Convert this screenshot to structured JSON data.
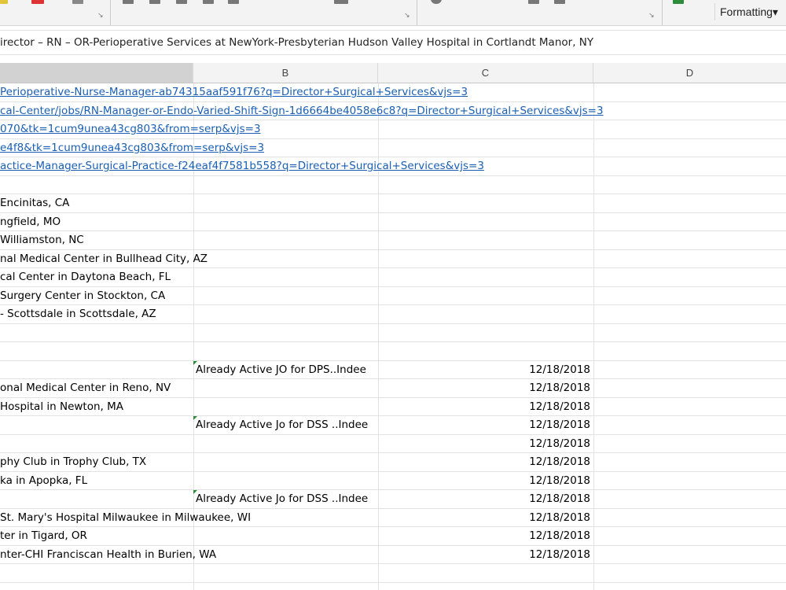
{
  "ribbon": {
    "formatting_label": "Formatting",
    "dropdown_glyph": "▾",
    "launcher_glyph": "↘"
  },
  "formula_bar": {
    "value": "irector – RN – OR-Perioperative Services at NewYork-Presbyterian Hudson Valley Hospital in Cortlandt Manor, NY"
  },
  "columns": [
    {
      "label": ""
    },
    {
      "label": "B"
    },
    {
      "label": "C"
    },
    {
      "label": "D"
    }
  ],
  "rows": [
    {
      "a": "Perioperative-Nurse-Manager-ab74315aaf591f76?q=Director+Surgical+Services&vjs=3",
      "a_link": true,
      "b": "",
      "c": ""
    },
    {
      "a": "cal-Center/jobs/RN-Manager-or-Endo-Varied-Shift-Sign-1d6664be4058e6c8?q=Director+Surgical+Services&vjs=3",
      "a_link": true,
      "b": "",
      "c": ""
    },
    {
      "a": "070&tk=1cum9unea43cg803&from=serp&vjs=3",
      "a_link": true,
      "b": "",
      "c": ""
    },
    {
      "a": "e4f8&tk=1cum9unea43cg803&from=serp&vjs=3",
      "a_link": true,
      "b": "",
      "c": ""
    },
    {
      "a": "actice-Manager-Surgical-Practice-f24eaf4f7581b558?q=Director+Surgical+Services&vjs=3",
      "a_link": true,
      "b": "",
      "c": ""
    },
    {
      "a": "",
      "b": "",
      "c": ""
    },
    {
      "a": "Encinitas, CA",
      "b": "",
      "c": ""
    },
    {
      "a": "ngfield, MO",
      "b": "",
      "c": ""
    },
    {
      "a": "Williamston, NC",
      "b": "",
      "c": ""
    },
    {
      "a": "nal Medical Center in Bullhead City, AZ",
      "b": "",
      "c": ""
    },
    {
      "a": "cal Center in Daytona Beach, FL",
      "b": "",
      "c": ""
    },
    {
      "a": "Surgery Center in Stockton, CA",
      "b": "",
      "c": ""
    },
    {
      "a": "- Scottsdale in Scottsdale, AZ",
      "b": "",
      "c": ""
    },
    {
      "a": "",
      "b": "",
      "c": ""
    },
    {
      "a": "",
      "b": "",
      "c": ""
    },
    {
      "a": "",
      "b": "Already Active JO for DPS..Indee",
      "b_comment": true,
      "c": "12/18/2018"
    },
    {
      "a": "onal Medical Center in Reno, NV",
      "b": "",
      "c": "12/18/2018"
    },
    {
      "a": "Hospital in Newton, MA",
      "b": "",
      "c": "12/18/2018"
    },
    {
      "a": "",
      "b": "Already Active Jo for DSS ..Indee",
      "b_comment": true,
      "c": "12/18/2018"
    },
    {
      "a": "",
      "b": "",
      "c": "12/18/2018"
    },
    {
      "a": "phy Club in Trophy Club, TX",
      "b": "",
      "c": "12/18/2018"
    },
    {
      "a": "ka in Apopka, FL",
      "b": "",
      "c": "12/18/2018"
    },
    {
      "a": "",
      "b": "Already Active Jo for DSS ..Indee",
      "b_comment": true,
      "c": "12/18/2018"
    },
    {
      "a": "St. Mary's Hospital Milwaukee in Milwaukee, WI",
      "b": "",
      "c": "12/18/2018"
    },
    {
      "a": "ter in Tigard, OR",
      "b": "",
      "c": "12/18/2018"
    },
    {
      "a": "nter-CHI Franciscan Health in Burien, WA",
      "b": "",
      "c": "12/18/2018"
    },
    {
      "a": "",
      "b": "",
      "c": ""
    },
    {
      "a": "",
      "b": "",
      "c": ""
    }
  ]
}
